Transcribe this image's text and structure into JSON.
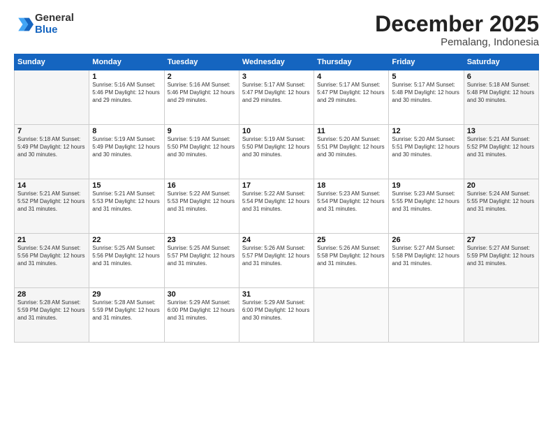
{
  "header": {
    "logo_line1": "General",
    "logo_line2": "Blue",
    "month": "December 2025",
    "location": "Pemalang, Indonesia"
  },
  "weekdays": [
    "Sunday",
    "Monday",
    "Tuesday",
    "Wednesday",
    "Thursday",
    "Friday",
    "Saturday"
  ],
  "weeks": [
    [
      {
        "day": "",
        "info": ""
      },
      {
        "day": "1",
        "info": "Sunrise: 5:16 AM\nSunset: 5:46 PM\nDaylight: 12 hours\nand 29 minutes."
      },
      {
        "day": "2",
        "info": "Sunrise: 5:16 AM\nSunset: 5:46 PM\nDaylight: 12 hours\nand 29 minutes."
      },
      {
        "day": "3",
        "info": "Sunrise: 5:17 AM\nSunset: 5:47 PM\nDaylight: 12 hours\nand 29 minutes."
      },
      {
        "day": "4",
        "info": "Sunrise: 5:17 AM\nSunset: 5:47 PM\nDaylight: 12 hours\nand 29 minutes."
      },
      {
        "day": "5",
        "info": "Sunrise: 5:17 AM\nSunset: 5:48 PM\nDaylight: 12 hours\nand 30 minutes."
      },
      {
        "day": "6",
        "info": "Sunrise: 5:18 AM\nSunset: 5:48 PM\nDaylight: 12 hours\nand 30 minutes."
      }
    ],
    [
      {
        "day": "7",
        "info": "Sunrise: 5:18 AM\nSunset: 5:49 PM\nDaylight: 12 hours\nand 30 minutes."
      },
      {
        "day": "8",
        "info": "Sunrise: 5:19 AM\nSunset: 5:49 PM\nDaylight: 12 hours\nand 30 minutes."
      },
      {
        "day": "9",
        "info": "Sunrise: 5:19 AM\nSunset: 5:50 PM\nDaylight: 12 hours\nand 30 minutes."
      },
      {
        "day": "10",
        "info": "Sunrise: 5:19 AM\nSunset: 5:50 PM\nDaylight: 12 hours\nand 30 minutes."
      },
      {
        "day": "11",
        "info": "Sunrise: 5:20 AM\nSunset: 5:51 PM\nDaylight: 12 hours\nand 30 minutes."
      },
      {
        "day": "12",
        "info": "Sunrise: 5:20 AM\nSunset: 5:51 PM\nDaylight: 12 hours\nand 30 minutes."
      },
      {
        "day": "13",
        "info": "Sunrise: 5:21 AM\nSunset: 5:52 PM\nDaylight: 12 hours\nand 31 minutes."
      }
    ],
    [
      {
        "day": "14",
        "info": "Sunrise: 5:21 AM\nSunset: 5:52 PM\nDaylight: 12 hours\nand 31 minutes."
      },
      {
        "day": "15",
        "info": "Sunrise: 5:21 AM\nSunset: 5:53 PM\nDaylight: 12 hours\nand 31 minutes."
      },
      {
        "day": "16",
        "info": "Sunrise: 5:22 AM\nSunset: 5:53 PM\nDaylight: 12 hours\nand 31 minutes."
      },
      {
        "day": "17",
        "info": "Sunrise: 5:22 AM\nSunset: 5:54 PM\nDaylight: 12 hours\nand 31 minutes."
      },
      {
        "day": "18",
        "info": "Sunrise: 5:23 AM\nSunset: 5:54 PM\nDaylight: 12 hours\nand 31 minutes."
      },
      {
        "day": "19",
        "info": "Sunrise: 5:23 AM\nSunset: 5:55 PM\nDaylight: 12 hours\nand 31 minutes."
      },
      {
        "day": "20",
        "info": "Sunrise: 5:24 AM\nSunset: 5:55 PM\nDaylight: 12 hours\nand 31 minutes."
      }
    ],
    [
      {
        "day": "21",
        "info": "Sunrise: 5:24 AM\nSunset: 5:56 PM\nDaylight: 12 hours\nand 31 minutes."
      },
      {
        "day": "22",
        "info": "Sunrise: 5:25 AM\nSunset: 5:56 PM\nDaylight: 12 hours\nand 31 minutes."
      },
      {
        "day": "23",
        "info": "Sunrise: 5:25 AM\nSunset: 5:57 PM\nDaylight: 12 hours\nand 31 minutes."
      },
      {
        "day": "24",
        "info": "Sunrise: 5:26 AM\nSunset: 5:57 PM\nDaylight: 12 hours\nand 31 minutes."
      },
      {
        "day": "25",
        "info": "Sunrise: 5:26 AM\nSunset: 5:58 PM\nDaylight: 12 hours\nand 31 minutes."
      },
      {
        "day": "26",
        "info": "Sunrise: 5:27 AM\nSunset: 5:58 PM\nDaylight: 12 hours\nand 31 minutes."
      },
      {
        "day": "27",
        "info": "Sunrise: 5:27 AM\nSunset: 5:59 PM\nDaylight: 12 hours\nand 31 minutes."
      }
    ],
    [
      {
        "day": "28",
        "info": "Sunrise: 5:28 AM\nSunset: 5:59 PM\nDaylight: 12 hours\nand 31 minutes."
      },
      {
        "day": "29",
        "info": "Sunrise: 5:28 AM\nSunset: 5:59 PM\nDaylight: 12 hours\nand 31 minutes."
      },
      {
        "day": "30",
        "info": "Sunrise: 5:29 AM\nSunset: 6:00 PM\nDaylight: 12 hours\nand 31 minutes."
      },
      {
        "day": "31",
        "info": "Sunrise: 5:29 AM\nSunset: 6:00 PM\nDaylight: 12 hours\nand 30 minutes."
      },
      {
        "day": "",
        "info": ""
      },
      {
        "day": "",
        "info": ""
      },
      {
        "day": "",
        "info": ""
      }
    ]
  ]
}
